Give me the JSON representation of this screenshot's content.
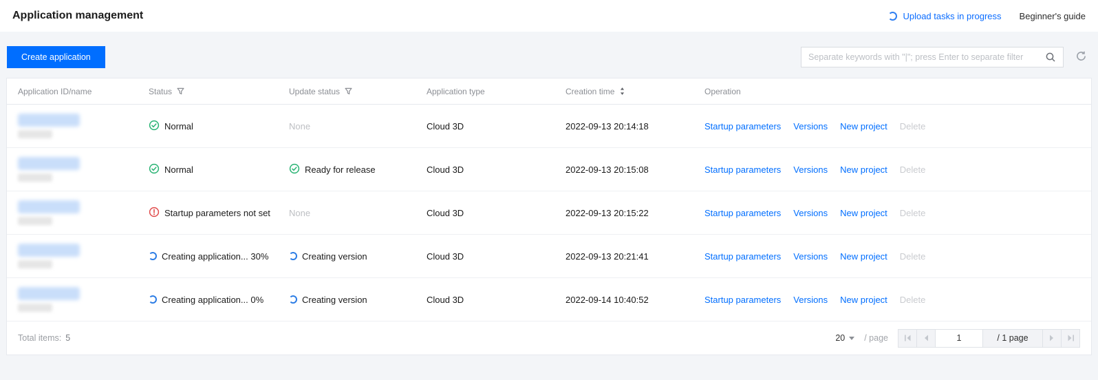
{
  "page": {
    "title": "Application management",
    "upload_tasks_label": "Upload tasks in progress",
    "guide_label": "Beginner's guide"
  },
  "toolbar": {
    "create_button": "Create application",
    "search_placeholder": "Separate keywords with \"|\"; press Enter to separate filter",
    "icons": [
      "search-icon",
      "refresh-icon"
    ]
  },
  "table": {
    "columns": {
      "id_name": "Application ID/name",
      "status": "Status",
      "update_status": "Update status",
      "app_type": "Application type",
      "creation_time": "Creation time",
      "operation": "Operation"
    },
    "op_labels": [
      "Startup parameters",
      "Versions",
      "New project",
      "Delete"
    ],
    "rows": [
      {
        "status": "Normal",
        "status_icon": "success",
        "update_status": "None",
        "update_icon": "none",
        "app_type": "Cloud 3D",
        "creation_time": "2022-09-13 20:14:18"
      },
      {
        "status": "Normal",
        "status_icon": "success",
        "update_status": "Ready for release",
        "update_icon": "success",
        "app_type": "Cloud 3D",
        "creation_time": "2022-09-13 20:15:08"
      },
      {
        "status": "Startup parameters not set",
        "status_icon": "error",
        "update_status": "None",
        "update_icon": "none",
        "app_type": "Cloud 3D",
        "creation_time": "2022-09-13 20:15:22"
      },
      {
        "status": "Creating application... 30%",
        "status_icon": "loading",
        "update_status": "Creating version",
        "update_icon": "loading",
        "app_type": "Cloud 3D",
        "creation_time": "2022-09-13 20:21:41"
      },
      {
        "status": "Creating application... 0%",
        "status_icon": "loading",
        "update_status": "Creating version",
        "update_icon": "loading",
        "app_type": "Cloud 3D",
        "creation_time": "2022-09-14 10:40:52"
      }
    ]
  },
  "footer": {
    "total_label": "Total items:",
    "total_count": "5",
    "page_size": "20",
    "per_page_label": "/ page",
    "current_page": "1",
    "page_total_label": "/ 1 page"
  },
  "colors": {
    "accent_blue": "#006eff",
    "success_green": "#28b373",
    "error_red": "#e04b4b",
    "loading_blue": "#2b7ce5"
  }
}
